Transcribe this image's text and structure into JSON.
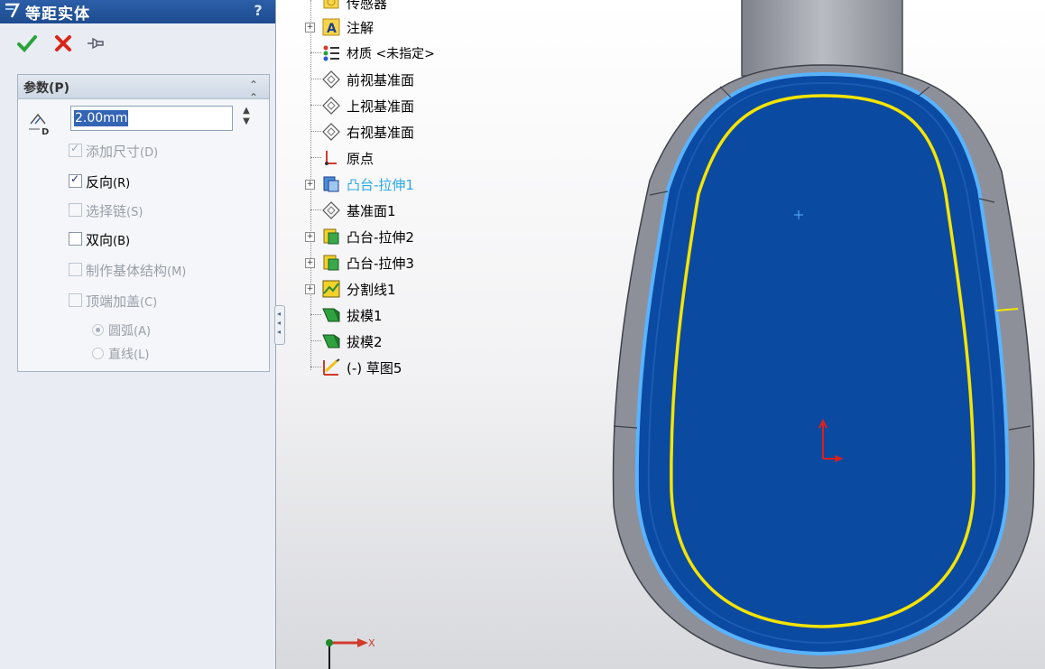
{
  "panel": {
    "title": "等距实体",
    "help": "?",
    "actions": {
      "ok": "confirm",
      "cancel": "cancel",
      "pin": "pin"
    },
    "group": {
      "title": "参数(P)",
      "collapse": "≈",
      "distance_value": "2.00mm",
      "options": [
        {
          "label": "添加尺寸",
          "key": "(D)",
          "checked": true,
          "enabled": false
        },
        {
          "label": "反向",
          "key": "(R)",
          "checked": true,
          "enabled": true
        },
        {
          "label": "选择链",
          "key": "(S)",
          "checked": false,
          "enabled": false
        },
        {
          "label": "双向",
          "key": "(B)",
          "checked": false,
          "enabled": true
        },
        {
          "label": "制作基体结构",
          "key": "(M)",
          "checked": false,
          "enabled": false
        },
        {
          "label": "顶端加盖",
          "key": "(C)",
          "checked": false,
          "enabled": false
        }
      ],
      "radios": [
        {
          "label": "圆弧",
          "key": "(A)",
          "selected": true
        },
        {
          "label": "直线",
          "key": "(L)",
          "selected": false
        }
      ]
    }
  },
  "tree": {
    "items": [
      {
        "label": "传感器",
        "icon": "sensor-icon",
        "expand": false
      },
      {
        "label": "注解",
        "icon": "annotation-icon",
        "expand": true
      },
      {
        "label": "材质 <未指定>",
        "icon": "material-icon",
        "expand": false
      },
      {
        "label": "前视基准面",
        "icon": "plane-icon",
        "expand": false
      },
      {
        "label": "上视基准面",
        "icon": "plane-icon",
        "expand": false
      },
      {
        "label": "右视基准面",
        "icon": "plane-icon",
        "expand": false
      },
      {
        "label": "原点",
        "icon": "origin-icon",
        "expand": false
      },
      {
        "label": "凸台-拉伸1",
        "icon": "extrude-icon",
        "expand": true,
        "selected": true
      },
      {
        "label": "基准面1",
        "icon": "plane-icon",
        "expand": false
      },
      {
        "label": "凸台-拉伸2",
        "icon": "extrude-icon",
        "expand": true
      },
      {
        "label": "凸台-拉伸3",
        "icon": "extrude-icon",
        "expand": true
      },
      {
        "label": "分割线1",
        "icon": "split-line-icon",
        "expand": true
      },
      {
        "label": "拔模1",
        "icon": "draft-icon",
        "expand": false
      },
      {
        "label": "拔模2",
        "icon": "draft-icon",
        "expand": false
      },
      {
        "label": "(-) 草图5",
        "icon": "sketch-icon",
        "expand": false
      }
    ]
  },
  "triad": {
    "x_label": "X"
  },
  "colors": {
    "face": "#0a4aa3",
    "offset_curve": "#f5e400",
    "edge_highlight": "#5ab3ff",
    "title_bar": "#1d4b8f",
    "selected_feature": "#29a8e6"
  }
}
